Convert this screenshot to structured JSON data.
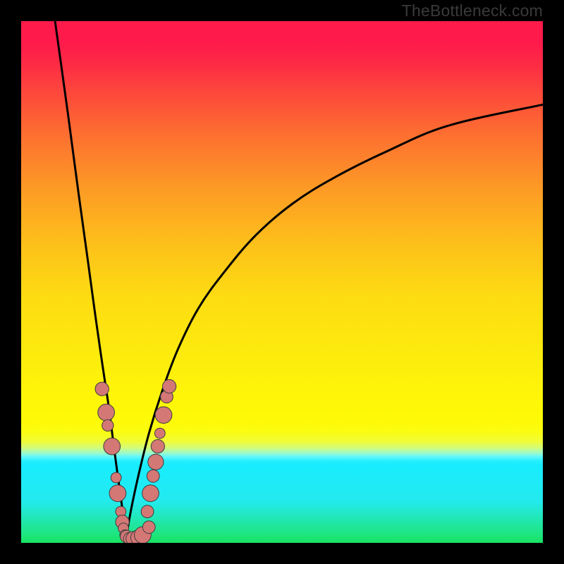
{
  "watermark": "TheBottleneck.com",
  "colors": {
    "frame": "#000000",
    "curve": "#000000",
    "dot_fill": "#d47876",
    "dot_stroke": "#3d3d3d",
    "gradient_top": "#fe1a4b",
    "gradient_mid": "#fdee0c",
    "gradient_band": "#58f6ff",
    "gradient_bottom": "#1ae462"
  },
  "chart_data": {
    "type": "line",
    "title": "",
    "xlabel": "",
    "ylabel": "",
    "xlim": [
      0,
      100
    ],
    "ylim": [
      0,
      100
    ],
    "notes": "V-shaped bottleneck curve with apex near x≈20, y≈0; left branch steep and nearly vertical, right branch concave rising to ~(100, 84). Clustered pink dots along both branches between y≈0 and y≈30.",
    "series": [
      {
        "name": "left-branch",
        "x": [
          6.5,
          9.0,
          11.0,
          12.8,
          14.3,
          15.6,
          16.8,
          17.7,
          18.5,
          19.2,
          19.7,
          20.0
        ],
        "values": [
          100,
          82,
          67,
          54,
          43,
          34,
          26,
          19,
          13,
          8,
          4,
          0
        ]
      },
      {
        "name": "right-branch",
        "x": [
          20.0,
          21.0,
          22.5,
          24.5,
          27.0,
          30.0,
          34.0,
          39.0,
          45.0,
          52.0,
          60.0,
          70.0,
          82.0,
          100.0
        ],
        "values": [
          0,
          6,
          13,
          21,
          29,
          37,
          45,
          52,
          59,
          65,
          70,
          75,
          80,
          84
        ]
      }
    ],
    "dots": [
      {
        "x": 15.5,
        "y": 29.5,
        "r": 1.3
      },
      {
        "x": 16.3,
        "y": 25.0,
        "r": 1.6
      },
      {
        "x": 16.6,
        "y": 22.5,
        "r": 1.1
      },
      {
        "x": 17.4,
        "y": 18.5,
        "r": 1.6
      },
      {
        "x": 18.2,
        "y": 12.5,
        "r": 1.0
      },
      {
        "x": 18.5,
        "y": 9.5,
        "r": 1.6
      },
      {
        "x": 19.1,
        "y": 6.0,
        "r": 1.0
      },
      {
        "x": 19.4,
        "y": 4.0,
        "r": 1.3
      },
      {
        "x": 19.6,
        "y": 2.8,
        "r": 1.0
      },
      {
        "x": 19.9,
        "y": 1.5,
        "r": 1.0
      },
      {
        "x": 20.2,
        "y": 1.2,
        "r": 1.2
      },
      {
        "x": 20.8,
        "y": 0.8,
        "r": 1.2
      },
      {
        "x": 21.5,
        "y": 0.8,
        "r": 1.4
      },
      {
        "x": 22.5,
        "y": 1.0,
        "r": 1.5
      },
      {
        "x": 23.3,
        "y": 1.5,
        "r": 1.6
      },
      {
        "x": 24.5,
        "y": 3.0,
        "r": 1.2
      },
      {
        "x": 24.2,
        "y": 6.0,
        "r": 1.2
      },
      {
        "x": 24.8,
        "y": 9.5,
        "r": 1.6
      },
      {
        "x": 25.3,
        "y": 12.8,
        "r": 1.2
      },
      {
        "x": 25.8,
        "y": 15.5,
        "r": 1.5
      },
      {
        "x": 26.2,
        "y": 18.5,
        "r": 1.3
      },
      {
        "x": 26.6,
        "y": 21.0,
        "r": 1.0
      },
      {
        "x": 27.3,
        "y": 24.5,
        "r": 1.6
      },
      {
        "x": 27.9,
        "y": 28.0,
        "r": 1.2
      },
      {
        "x": 28.4,
        "y": 30.0,
        "r": 1.3
      }
    ]
  }
}
